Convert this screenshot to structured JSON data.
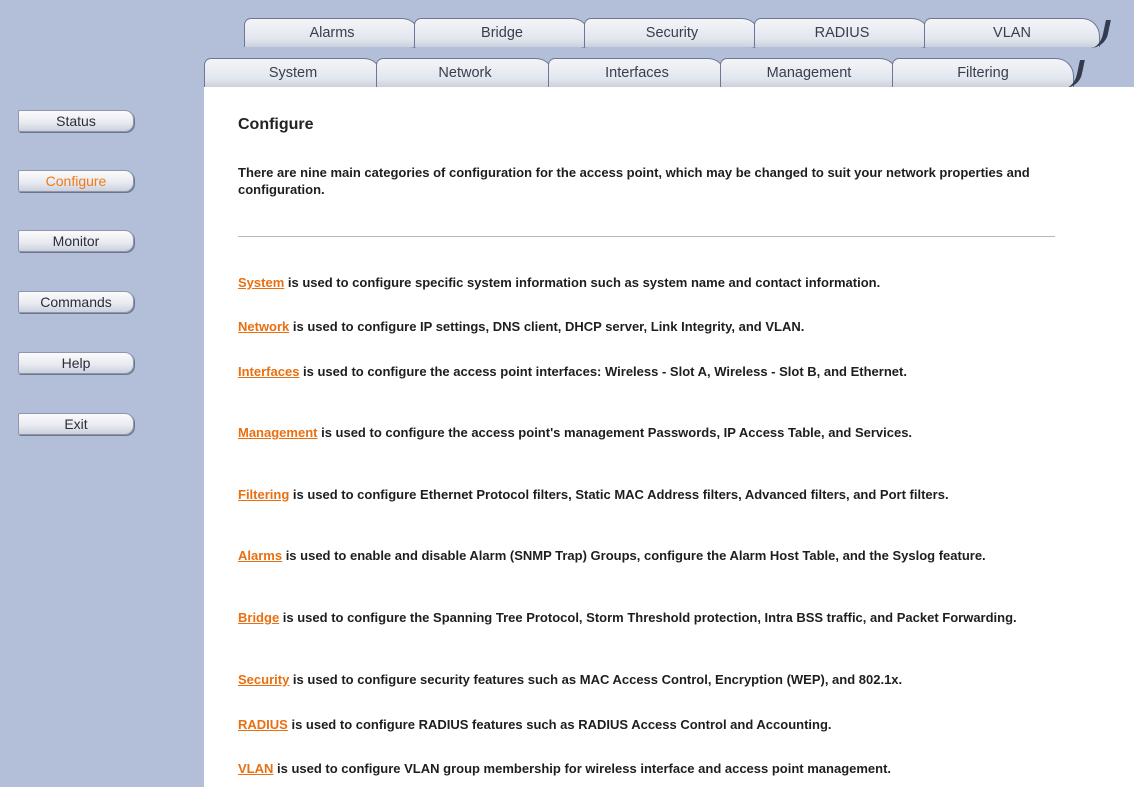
{
  "tabs": {
    "top": [
      "Alarms",
      "Bridge",
      "Security",
      "RADIUS",
      "VLAN"
    ],
    "bottom": [
      "System",
      "Network",
      "Interfaces",
      "Management",
      "Filtering"
    ]
  },
  "sidebar": {
    "items": [
      "Status",
      "Configure",
      "Monitor",
      "Commands",
      "Help",
      "Exit"
    ],
    "active": "Configure"
  },
  "main": {
    "title": "Configure",
    "intro": "There are nine main categories of configuration for the access point, which may be changed to suit your network properties and configuration.",
    "items": [
      {
        "link": "System",
        "text": " is used to configure specific system information such as system name and contact information."
      },
      {
        "link": "Network",
        "text": " is used to configure IP settings, DNS client, DHCP server, Link Integrity, and VLAN."
      },
      {
        "link": "Interfaces",
        "text": " is used to configure the access point interfaces: Wireless - Slot A, Wireless - Slot B, and Ethernet."
      },
      {
        "link": "Management",
        "text": " is used to configure the access point's management Passwords, IP Access Table, and Services."
      },
      {
        "link": "Filtering",
        "text": " is used to configure Ethernet Protocol filters, Static MAC Address filters, Advanced filters, and Port filters."
      },
      {
        "link": "Alarms",
        "text": " is used to enable and disable Alarm (SNMP Trap) Groups, configure the Alarm Host Table, and the Syslog feature."
      },
      {
        "link": "Bridge",
        "text": " is used to configure the Spanning Tree Protocol, Storm Threshold protection, Intra BSS traffic, and Packet Forwarding."
      },
      {
        "link": "Security",
        "text": " is used to configure security features such as MAC Access Control, Encryption (WEP), and 802.1x."
      },
      {
        "link": "RADIUS",
        "text": " is used to configure RADIUS features such as RADIUS Access Control and Accounting."
      },
      {
        "link": "VLAN",
        "text": " is used to configure VLAN group membership for wireless interface and access point management."
      }
    ]
  },
  "colors": {
    "sidebar_bg": "#b3bfd9",
    "link": "#ea6f10",
    "active_nav": "#f07a17"
  }
}
